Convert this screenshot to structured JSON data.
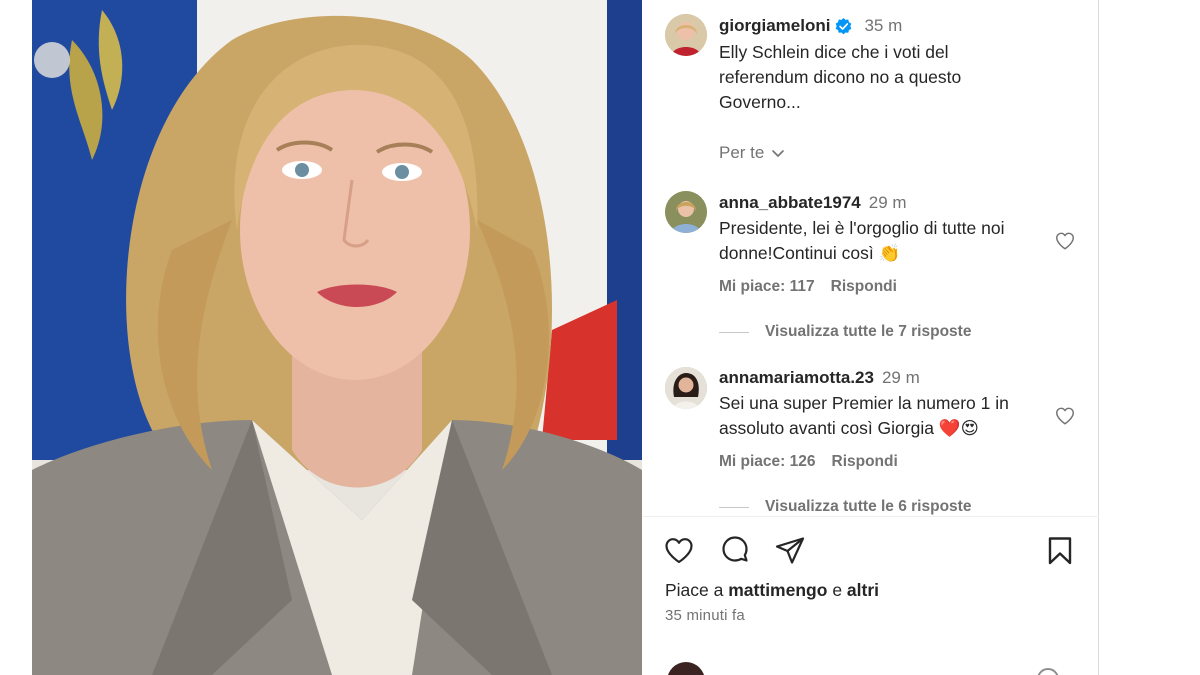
{
  "post": {
    "author": "giorgiameloni",
    "time": "35 m",
    "caption": "Elly Schlein dice che i voti del referendum dicono no a questo Governo...",
    "filter_label": "Per te"
  },
  "comments": [
    {
      "username": "anna_abbate1974",
      "time": "29 m",
      "text": "Presidente, lei è l'orgoglio di tutte noi donne!Continui così 👏",
      "likes_label": "Mi piace: 117",
      "reply_label": "Rispondi",
      "view_replies": "Visualizza tutte le 7 risposte"
    },
    {
      "username": "annamariamotta.23",
      "time": "29 m",
      "text": "Sei una super Premier la numero 1 in assoluto avanti così Giorgia ❤️😍",
      "likes_label": "Mi piace: 126",
      "reply_label": "Rispondi",
      "view_replies": "Visualizza tutte le 6 risposte"
    }
  ],
  "likes": {
    "prefix": "Piace a",
    "user": "mattimengo",
    "conjunction": "e",
    "others": "altri"
  },
  "posted_ago": "35 minuti fa",
  "icons": {
    "like": "heart-icon",
    "comment": "comment-icon",
    "share": "share-icon",
    "save": "bookmark-icon",
    "verified": "verified-badge-icon"
  },
  "colors": {
    "verified": "#0095f6",
    "text": "#262626",
    "muted": "#737373",
    "flag_blue": "#1f4aa0",
    "flag_red": "#d8322c"
  }
}
